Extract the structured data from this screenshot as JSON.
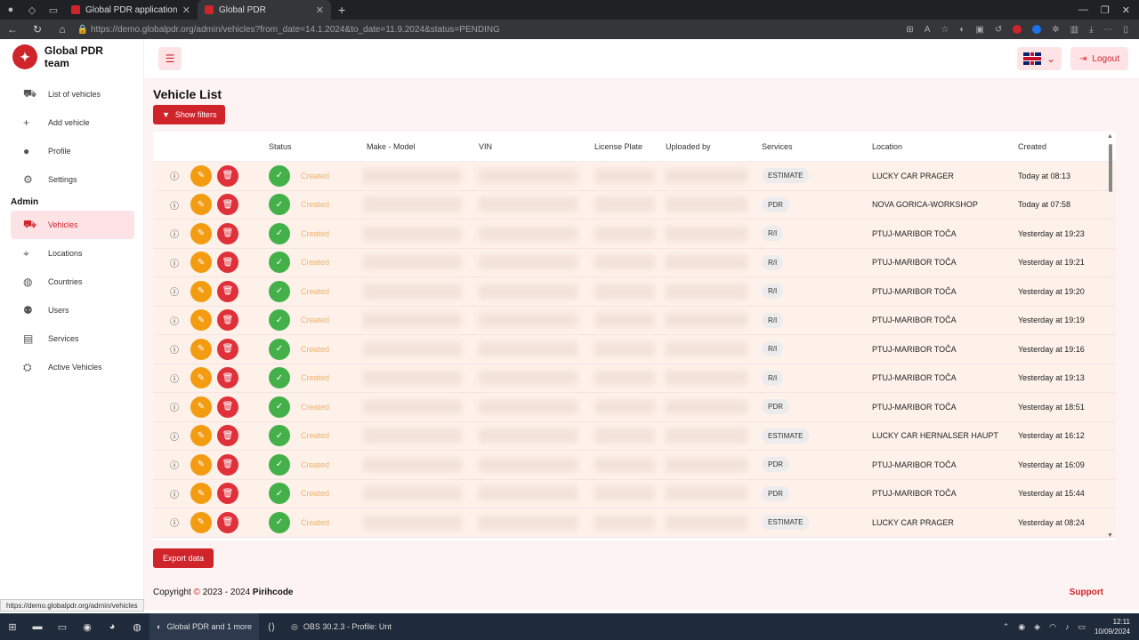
{
  "browser": {
    "tabs": [
      {
        "label": "Global PDR application",
        "active": false
      },
      {
        "label": "Global PDR",
        "active": true
      }
    ],
    "url": "https://demo.globalpdr.org/admin/vehicles?from_date=14.1.2024&to_date=11.9.2024&status=PENDING",
    "status_url": "https://demo.globalpdr.org/admin/vehicles"
  },
  "sidebar": {
    "brand": "Global PDR team",
    "items": [
      {
        "label": "List of vehicles",
        "icon": "car-icon"
      },
      {
        "label": "Add vehicle",
        "icon": "plus-icon"
      },
      {
        "label": "Profile",
        "icon": "person-icon"
      },
      {
        "label": "Settings",
        "icon": "gear-icon"
      }
    ],
    "admin_label": "Admin",
    "admin_items": [
      {
        "label": "Vehicles",
        "icon": "car-icon",
        "active": true
      },
      {
        "label": "Locations",
        "icon": "pin-icon"
      },
      {
        "label": "Countries",
        "icon": "globe-icon"
      },
      {
        "label": "Users",
        "icon": "users-icon"
      },
      {
        "label": "Services",
        "icon": "toolbox-icon"
      },
      {
        "label": "Active Vehicles",
        "icon": "car-gear-icon"
      }
    ]
  },
  "header": {
    "logout": "Logout",
    "language": "EN"
  },
  "main": {
    "title": "Vehicle List",
    "show_filters": "Show filters",
    "export": "Export data",
    "columns": [
      "Status",
      "Make - Model",
      "VIN",
      "License Plate",
      "Uploaded by",
      "Services",
      "Location",
      "Created"
    ],
    "rows": [
      {
        "status": "Created",
        "service": "ESTIMATE",
        "location": "LUCKY CAR PRAGER",
        "created": "Today at 08:13"
      },
      {
        "status": "Created",
        "service": "PDR",
        "location": "NOVA GORICA-WORKSHOP",
        "created": "Today at 07:58"
      },
      {
        "status": "Created",
        "service": "R/I",
        "location": "PTUJ-MARIBOR TOČA",
        "created": "Yesterday at 19:23"
      },
      {
        "status": "Created",
        "service": "R/I",
        "location": "PTUJ-MARIBOR TOČA",
        "created": "Yesterday at 19:21"
      },
      {
        "status": "Created",
        "service": "R/I",
        "location": "PTUJ-MARIBOR TOČA",
        "created": "Yesterday at 19:20"
      },
      {
        "status": "Created",
        "service": "R/I",
        "location": "PTUJ-MARIBOR TOČA",
        "created": "Yesterday at 19:19"
      },
      {
        "status": "Created",
        "service": "R/I",
        "location": "PTUJ-MARIBOR TOČA",
        "created": "Yesterday at 19:16"
      },
      {
        "status": "Created",
        "service": "R/I",
        "location": "PTUJ-MARIBOR TOČA",
        "created": "Yesterday at 19:13"
      },
      {
        "status": "Created",
        "service": "PDR",
        "location": "PTUJ-MARIBOR TOČA",
        "created": "Yesterday at 18:51"
      },
      {
        "status": "Created",
        "service": "ESTIMATE",
        "location": "LUCKY CAR HERNALSER HAUPT",
        "created": "Yesterday at 16:12"
      },
      {
        "status": "Created",
        "service": "PDR",
        "location": "PTUJ-MARIBOR TOČA",
        "created": "Yesterday at 16:09"
      },
      {
        "status": "Created",
        "service": "PDR",
        "location": "PTUJ-MARIBOR TOČA",
        "created": "Yesterday at 15:44"
      },
      {
        "status": "Created",
        "service": "ESTIMATE",
        "location": "LUCKY CAR PRAGER",
        "created": "Yesterday at 08:24"
      }
    ]
  },
  "footer": {
    "copyright": "Copyright",
    "years": "2023 - 2024",
    "company": "Pirihcode",
    "support": "Support"
  },
  "taskbar": {
    "browser_app": "Global PDR and 1 more",
    "obs_app": "OBS 30.2.3 - Profile: Unt",
    "time": "12:11",
    "date": "10/09/2024"
  }
}
